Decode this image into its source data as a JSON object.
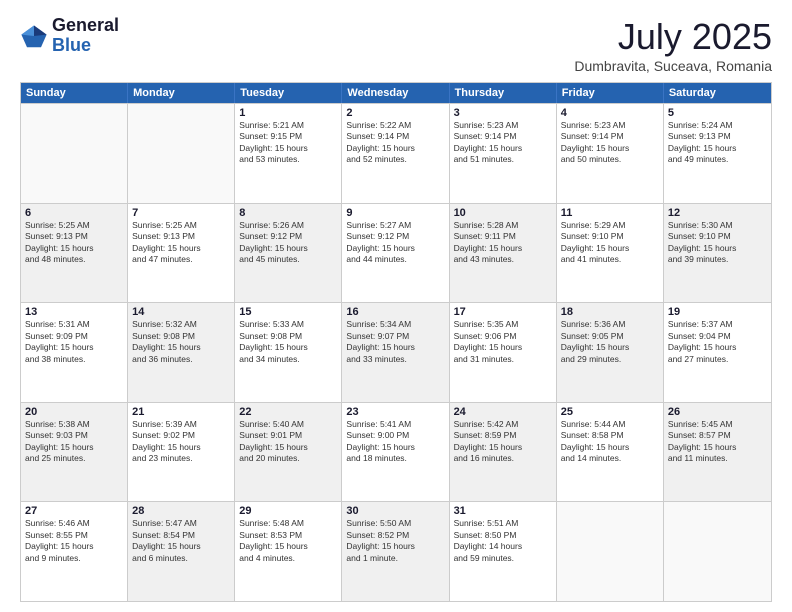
{
  "logo": {
    "general": "General",
    "blue": "Blue"
  },
  "title": "July 2025",
  "subtitle": "Dumbravita, Suceava, Romania",
  "weekdays": [
    "Sunday",
    "Monday",
    "Tuesday",
    "Wednesday",
    "Thursday",
    "Friday",
    "Saturday"
  ],
  "weeks": [
    [
      {
        "day": "",
        "lines": [],
        "empty": true
      },
      {
        "day": "",
        "lines": [],
        "empty": true
      },
      {
        "day": "1",
        "lines": [
          "Sunrise: 5:21 AM",
          "Sunset: 9:15 PM",
          "Daylight: 15 hours",
          "and 53 minutes."
        ]
      },
      {
        "day": "2",
        "lines": [
          "Sunrise: 5:22 AM",
          "Sunset: 9:14 PM",
          "Daylight: 15 hours",
          "and 52 minutes."
        ]
      },
      {
        "day": "3",
        "lines": [
          "Sunrise: 5:23 AM",
          "Sunset: 9:14 PM",
          "Daylight: 15 hours",
          "and 51 minutes."
        ]
      },
      {
        "day": "4",
        "lines": [
          "Sunrise: 5:23 AM",
          "Sunset: 9:14 PM",
          "Daylight: 15 hours",
          "and 50 minutes."
        ]
      },
      {
        "day": "5",
        "lines": [
          "Sunrise: 5:24 AM",
          "Sunset: 9:13 PM",
          "Daylight: 15 hours",
          "and 49 minutes."
        ]
      }
    ],
    [
      {
        "day": "6",
        "lines": [
          "Sunrise: 5:25 AM",
          "Sunset: 9:13 PM",
          "Daylight: 15 hours",
          "and 48 minutes."
        ],
        "shaded": true
      },
      {
        "day": "7",
        "lines": [
          "Sunrise: 5:25 AM",
          "Sunset: 9:13 PM",
          "Daylight: 15 hours",
          "and 47 minutes."
        ]
      },
      {
        "day": "8",
        "lines": [
          "Sunrise: 5:26 AM",
          "Sunset: 9:12 PM",
          "Daylight: 15 hours",
          "and 45 minutes."
        ],
        "shaded": true
      },
      {
        "day": "9",
        "lines": [
          "Sunrise: 5:27 AM",
          "Sunset: 9:12 PM",
          "Daylight: 15 hours",
          "and 44 minutes."
        ]
      },
      {
        "day": "10",
        "lines": [
          "Sunrise: 5:28 AM",
          "Sunset: 9:11 PM",
          "Daylight: 15 hours",
          "and 43 minutes."
        ],
        "shaded": true
      },
      {
        "day": "11",
        "lines": [
          "Sunrise: 5:29 AM",
          "Sunset: 9:10 PM",
          "Daylight: 15 hours",
          "and 41 minutes."
        ]
      },
      {
        "day": "12",
        "lines": [
          "Sunrise: 5:30 AM",
          "Sunset: 9:10 PM",
          "Daylight: 15 hours",
          "and 39 minutes."
        ],
        "shaded": true
      }
    ],
    [
      {
        "day": "13",
        "lines": [
          "Sunrise: 5:31 AM",
          "Sunset: 9:09 PM",
          "Daylight: 15 hours",
          "and 38 minutes."
        ]
      },
      {
        "day": "14",
        "lines": [
          "Sunrise: 5:32 AM",
          "Sunset: 9:08 PM",
          "Daylight: 15 hours",
          "and 36 minutes."
        ],
        "shaded": true
      },
      {
        "day": "15",
        "lines": [
          "Sunrise: 5:33 AM",
          "Sunset: 9:08 PM",
          "Daylight: 15 hours",
          "and 34 minutes."
        ]
      },
      {
        "day": "16",
        "lines": [
          "Sunrise: 5:34 AM",
          "Sunset: 9:07 PM",
          "Daylight: 15 hours",
          "and 33 minutes."
        ],
        "shaded": true
      },
      {
        "day": "17",
        "lines": [
          "Sunrise: 5:35 AM",
          "Sunset: 9:06 PM",
          "Daylight: 15 hours",
          "and 31 minutes."
        ]
      },
      {
        "day": "18",
        "lines": [
          "Sunrise: 5:36 AM",
          "Sunset: 9:05 PM",
          "Daylight: 15 hours",
          "and 29 minutes."
        ],
        "shaded": true
      },
      {
        "day": "19",
        "lines": [
          "Sunrise: 5:37 AM",
          "Sunset: 9:04 PM",
          "Daylight: 15 hours",
          "and 27 minutes."
        ]
      }
    ],
    [
      {
        "day": "20",
        "lines": [
          "Sunrise: 5:38 AM",
          "Sunset: 9:03 PM",
          "Daylight: 15 hours",
          "and 25 minutes."
        ],
        "shaded": true
      },
      {
        "day": "21",
        "lines": [
          "Sunrise: 5:39 AM",
          "Sunset: 9:02 PM",
          "Daylight: 15 hours",
          "and 23 minutes."
        ]
      },
      {
        "day": "22",
        "lines": [
          "Sunrise: 5:40 AM",
          "Sunset: 9:01 PM",
          "Daylight: 15 hours",
          "and 20 minutes."
        ],
        "shaded": true
      },
      {
        "day": "23",
        "lines": [
          "Sunrise: 5:41 AM",
          "Sunset: 9:00 PM",
          "Daylight: 15 hours",
          "and 18 minutes."
        ]
      },
      {
        "day": "24",
        "lines": [
          "Sunrise: 5:42 AM",
          "Sunset: 8:59 PM",
          "Daylight: 15 hours",
          "and 16 minutes."
        ],
        "shaded": true
      },
      {
        "day": "25",
        "lines": [
          "Sunrise: 5:44 AM",
          "Sunset: 8:58 PM",
          "Daylight: 15 hours",
          "and 14 minutes."
        ]
      },
      {
        "day": "26",
        "lines": [
          "Sunrise: 5:45 AM",
          "Sunset: 8:57 PM",
          "Daylight: 15 hours",
          "and 11 minutes."
        ],
        "shaded": true
      }
    ],
    [
      {
        "day": "27",
        "lines": [
          "Sunrise: 5:46 AM",
          "Sunset: 8:55 PM",
          "Daylight: 15 hours",
          "and 9 minutes."
        ]
      },
      {
        "day": "28",
        "lines": [
          "Sunrise: 5:47 AM",
          "Sunset: 8:54 PM",
          "Daylight: 15 hours",
          "and 6 minutes."
        ],
        "shaded": true
      },
      {
        "day": "29",
        "lines": [
          "Sunrise: 5:48 AM",
          "Sunset: 8:53 PM",
          "Daylight: 15 hours",
          "and 4 minutes."
        ]
      },
      {
        "day": "30",
        "lines": [
          "Sunrise: 5:50 AM",
          "Sunset: 8:52 PM",
          "Daylight: 15 hours",
          "and 1 minute."
        ],
        "shaded": true
      },
      {
        "day": "31",
        "lines": [
          "Sunrise: 5:51 AM",
          "Sunset: 8:50 PM",
          "Daylight: 14 hours",
          "and 59 minutes."
        ]
      },
      {
        "day": "",
        "lines": [],
        "empty": true
      },
      {
        "day": "",
        "lines": [],
        "empty": true
      }
    ]
  ]
}
